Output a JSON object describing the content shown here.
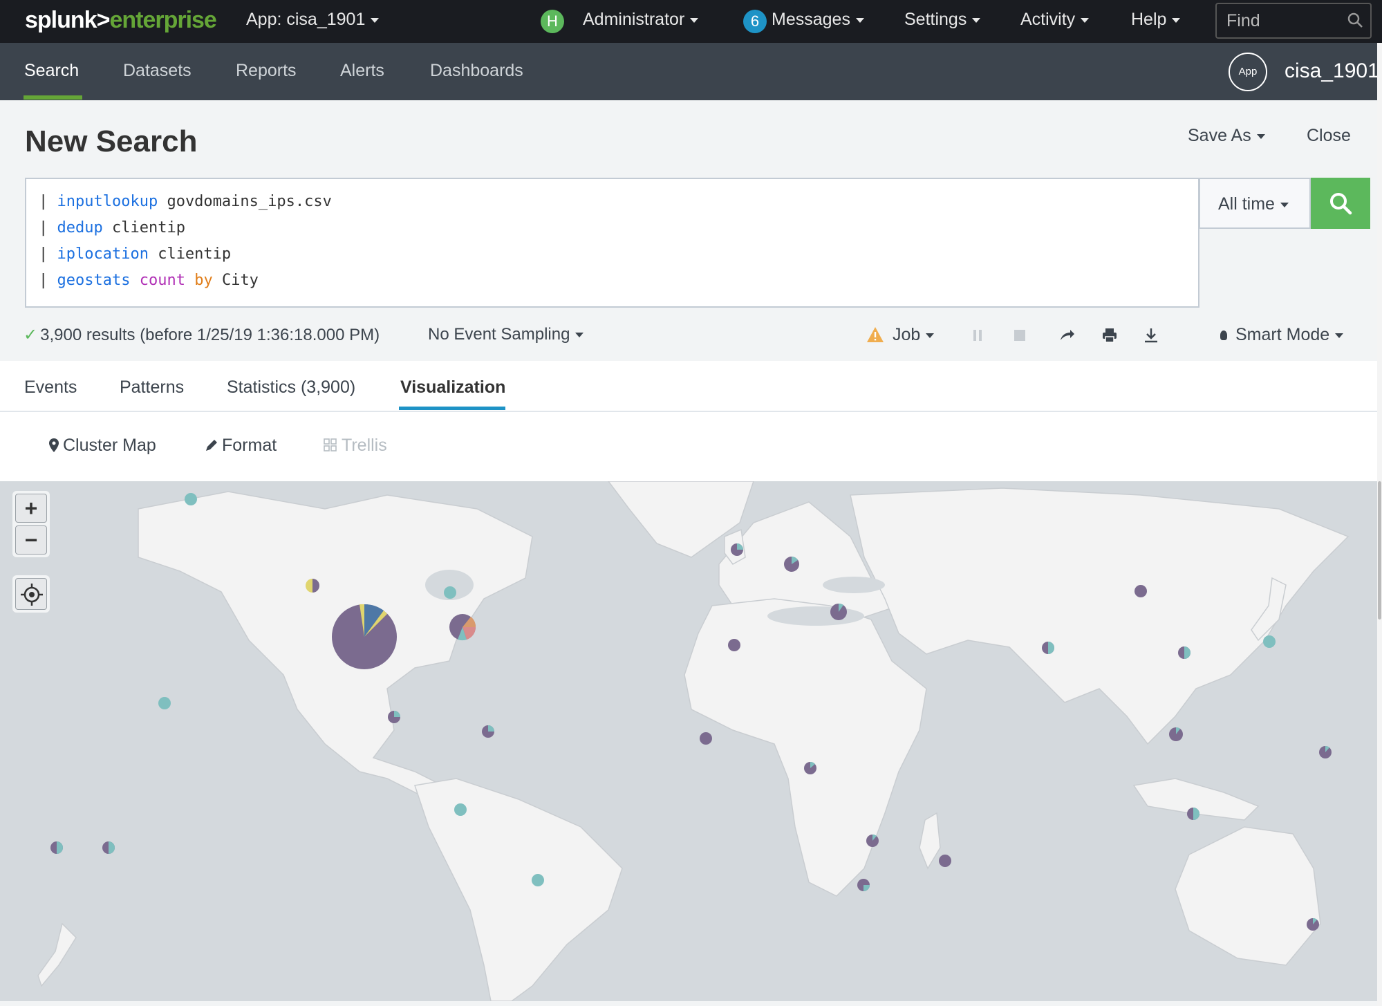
{
  "topbar": {
    "logo_part1": "splunk>",
    "logo_part2": "enterprise",
    "app_selector": "App: cisa_1901",
    "user_initial": "H",
    "user_name": "Administrator",
    "messages_count": "6",
    "messages_label": "Messages",
    "settings_label": "Settings",
    "activity_label": "Activity",
    "help_label": "Help",
    "find_placeholder": "Find"
  },
  "appbar": {
    "tabs": [
      {
        "label": "Search",
        "active": true
      },
      {
        "label": "Datasets"
      },
      {
        "label": "Reports"
      },
      {
        "label": "Alerts"
      },
      {
        "label": "Dashboards"
      }
    ],
    "app_icon_label": "App",
    "app_name": "cisa_1901"
  },
  "page": {
    "title": "New Search",
    "save_as": "Save As",
    "close": "Close"
  },
  "search": {
    "lines": [
      {
        "pipe": "| ",
        "command": "inputlookup",
        "args": " govdomains_ips.csv"
      },
      {
        "pipe": "| ",
        "command": "dedup",
        "args": " clientip"
      },
      {
        "pipe": "| ",
        "command": "iplocation",
        "args": " clientip"
      },
      {
        "pipe": "| ",
        "command": "geostats",
        "fn": " count",
        "kw": " by",
        "args": " City"
      }
    ],
    "time_range": "All time"
  },
  "status": {
    "results": "3,900 results (before 1/25/19 1:36:18.000 PM)",
    "sampling": "No Event Sampling",
    "job": "Job",
    "mode": "Smart Mode"
  },
  "result_tabs": [
    {
      "label": "Events"
    },
    {
      "label": "Patterns"
    },
    {
      "label": "Statistics (3,900)"
    },
    {
      "label": "Visualization",
      "active": true
    }
  ],
  "viz_toolbar": {
    "type": "Cluster Map",
    "format": "Format",
    "trellis": "Trellis"
  },
  "map": {
    "zoom_in": "+",
    "zoom_out": "−",
    "colors": {
      "purple": "#7b6b8f",
      "teal": "#7fbfbf",
      "yellow": "#e0d56e",
      "orange": "#d99a6c",
      "pink": "#d98b8b",
      "blue": "#4e78a6"
    }
  }
}
